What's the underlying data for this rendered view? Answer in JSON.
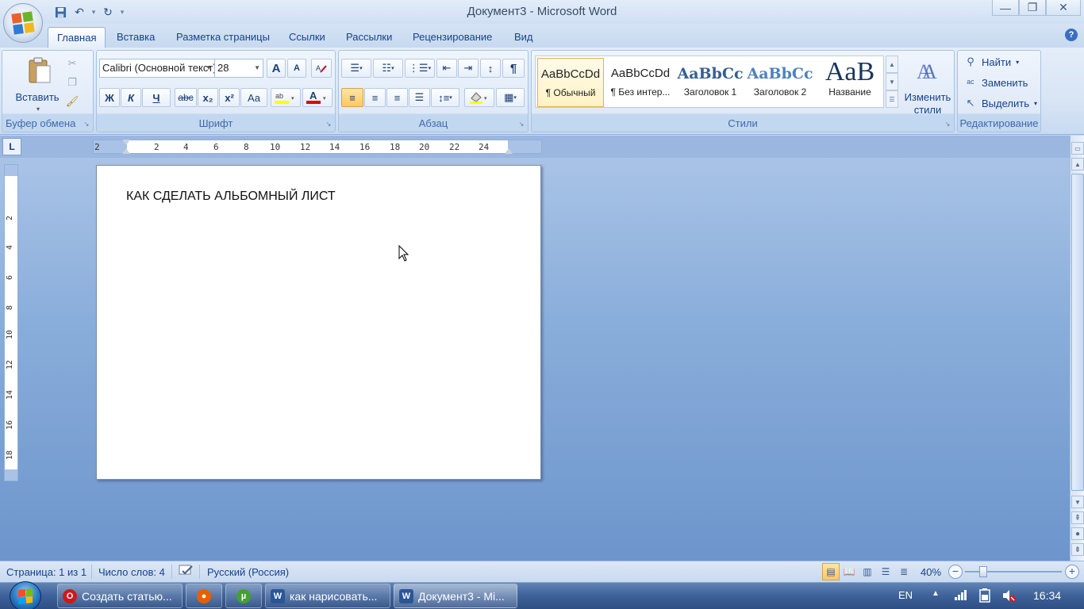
{
  "window": {
    "title": "Документ3 - Microsoft Word",
    "minimize": "—",
    "maximize": "❐",
    "close": "✕"
  },
  "qat": {
    "save_icon": "floppy-disk-icon",
    "undo_icon": "undo-icon",
    "redo_icon": "redo-icon"
  },
  "tabs": [
    {
      "label": "Главная",
      "active": true
    },
    {
      "label": "Вставка",
      "active": false
    },
    {
      "label": "Разметка страницы",
      "active": false
    },
    {
      "label": "Ссылки",
      "active": false
    },
    {
      "label": "Рассылки",
      "active": false
    },
    {
      "label": "Рецензирование",
      "active": false
    },
    {
      "label": "Вид",
      "active": false
    }
  ],
  "ribbon": {
    "clipboard": {
      "label": "Буфер обмена",
      "paste_label": "Вставить"
    },
    "font": {
      "label": "Шрифт",
      "font_name": "Calibri (Основной текст)",
      "font_size": "28",
      "bold": "Ж",
      "italic": "К",
      "underline": "Ч",
      "strike": "abc",
      "subscript": "x₂",
      "superscript": "x²",
      "case": "Aa",
      "grow": "A",
      "shrink": "A"
    },
    "paragraph": {
      "label": "Абзац",
      "pilcrow": "¶"
    },
    "styles": {
      "label": "Стили",
      "items": [
        {
          "sample": "AaBbCcDd",
          "name": "¶ Обычный",
          "selected": true
        },
        {
          "sample": "AaBbCcDd",
          "name": "¶ Без интер...",
          "selected": false
        },
        {
          "sample": "AaBbCc",
          "name": "Заголовок 1",
          "selected": false
        },
        {
          "sample": "AaBbCc",
          "name": "Заголовок 2",
          "selected": false
        },
        {
          "sample": "AaB",
          "name": "Название",
          "selected": false
        }
      ],
      "change_label_1": "Изменить",
      "change_label_2": "стили"
    },
    "editing": {
      "label": "Редактирование",
      "find": "Найти",
      "replace": "Заменить",
      "select": "Выделить"
    }
  },
  "ruler": {
    "corner": "L",
    "h_numbers": [
      "2",
      "2",
      "4",
      "6",
      "8",
      "10",
      "12",
      "14",
      "16",
      "18",
      "20",
      "22",
      "24"
    ],
    "v_numbers": [
      "2",
      "4",
      "6",
      "8",
      "10",
      "12",
      "14",
      "16",
      "18"
    ]
  },
  "document": {
    "text": "КАК СДЕЛАТЬ АЛЬБОМНЫЙ ЛИСТ"
  },
  "status": {
    "page": "Страница: 1 из 1",
    "words": "Число слов: 4",
    "language": "Русский (Россия)",
    "zoom": "40%",
    "zoom_value": 40
  },
  "taskbar": {
    "items": [
      {
        "label": "Создать статью...",
        "icon": "opera-icon",
        "color": "#cc1a1a",
        "glyph": "O"
      },
      {
        "label": "",
        "icon": "firefox-icon",
        "color": "#e66000",
        "glyph": "●"
      },
      {
        "label": "",
        "icon": "utorrent-icon",
        "color": "#44a032",
        "glyph": "µ"
      },
      {
        "label": "как нарисовать...",
        "icon": "word-icon",
        "color": "#2a5699",
        "glyph": "W"
      },
      {
        "label": "Документ3 - Mi...",
        "icon": "word-icon",
        "color": "#2a5699",
        "glyph": "W"
      }
    ],
    "lang": "EN",
    "time": "16:34"
  }
}
